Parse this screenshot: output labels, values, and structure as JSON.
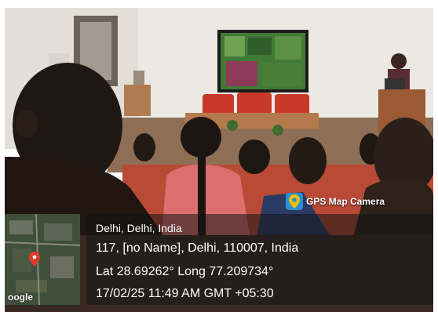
{
  "overlay": {
    "app_badge": "GPS Map Camera",
    "map_attribution": "oogle",
    "location_title": "Delhi, Delhi, India",
    "address": "117, [no Name], Delhi, 110007, India",
    "coordinates": "Lat 28.69262° Long 77.209734°",
    "timestamp": "17/02/25 11:49 AM GMT +05:30",
    "icon": "map-pin-icon"
  },
  "colors": {
    "wall": "#ece8e3",
    "chair_red": "#c8392b",
    "screen_green": "#3f7a36",
    "panel_bg": "#141414"
  }
}
